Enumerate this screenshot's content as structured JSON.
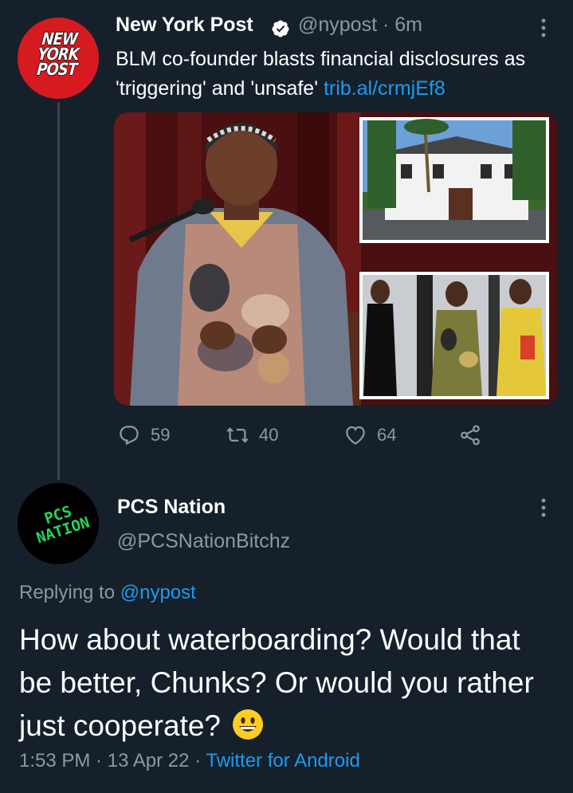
{
  "original_tweet": {
    "author_name": "New York Post",
    "handle": "@nypost",
    "separator": " · ",
    "time": "6m",
    "avatar_text": "NEW YORK POST",
    "avatar_color": "#d71920",
    "text": "BLM co-founder blasts financial disclosures as 'triggering' and 'unsafe' ",
    "link": "trib.al/crmjEf8",
    "replies": "59",
    "retweets": "40",
    "likes": "64"
  },
  "reply_tweet": {
    "author_name": "PCS Nation",
    "handle": "@PCSNationBitchz",
    "avatar_text": "PCS NATION",
    "avatar_color": "#000000",
    "replying_label": "Replying to ",
    "replying_handle": "@nypost",
    "text": "How about waterboarding? Would that be better, Chunks? Or would you rather just cooperate?",
    "emoji": "grinning-face",
    "time": "1:53 PM",
    "date": "13 Apr 22",
    "client": "Twitter for Android",
    "separator": " · "
  },
  "colors": {
    "background": "#15202b",
    "text_primary": "#ffffff",
    "text_secondary": "#8b98a5",
    "accent": "#1d9bf0",
    "thread_line": "#38444d"
  },
  "icons": [
    "verified-badge-icon",
    "more-options-icon",
    "reply-icon",
    "retweet-icon",
    "like-icon",
    "share-icon",
    "grinning-face-emoji"
  ]
}
